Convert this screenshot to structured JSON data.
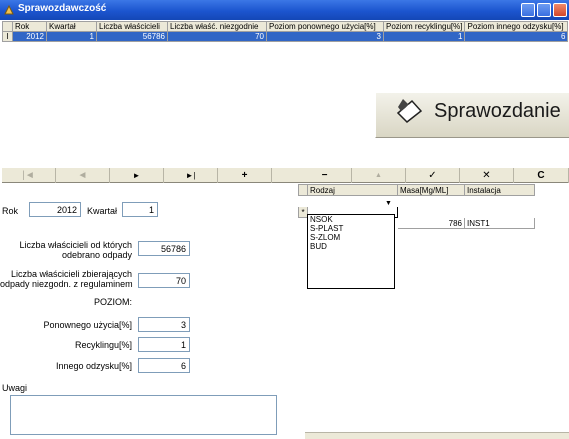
{
  "window": {
    "title": "Sprawozdawczość"
  },
  "top_grid": {
    "columns": [
      "Rok",
      "Kwartał",
      "Liczba właścicieli",
      "Liczba właść. niezgodnie",
      "Poziom ponownego użycia[%]",
      "Poziom recyklingu[%]",
      "Poziom innego odzysku[%]"
    ],
    "rows": [
      [
        "2012",
        "1",
        "56786",
        "70",
        "3",
        "1",
        "6"
      ]
    ],
    "row_indicator": "I"
  },
  "banner": {
    "label": "Sprawozdanie"
  },
  "navigator": {
    "buttons": [
      {
        "name": "first",
        "glyph": "|◄"
      },
      {
        "name": "prior",
        "glyph": "◄"
      },
      {
        "name": "next",
        "glyph": "►"
      },
      {
        "name": "last",
        "glyph": "►|"
      },
      {
        "name": "insert",
        "glyph": "+"
      },
      {
        "name": "delete",
        "glyph": "−"
      },
      {
        "name": "edit",
        "glyph": "▲"
      },
      {
        "name": "post",
        "glyph": "✓"
      },
      {
        "name": "cancel",
        "glyph": "✕"
      },
      {
        "name": "refresh",
        "glyph": "C"
      }
    ]
  },
  "form": {
    "rok_label": "Rok",
    "rok_value": "2012",
    "kwartal_label": "Kwartał",
    "kwartal_value": "1",
    "liczba_label_1": "Liczba właścicieli od których",
    "liczba_label_2": "odebrano odpady",
    "liczba_value": "56786",
    "niezgodn_label_1": "Liczba właścicieli zbierających",
    "niezgodn_label_2": "odpady niezgodn. z regulaminem",
    "niezgodn_value": "70",
    "poziom_heading": "POZIOM:",
    "ponownego_label": "Ponownego użycia[%]",
    "ponownego_value": "3",
    "recyklingu_label": "Recyklingu[%]",
    "recyklingu_value": "1",
    "innego_label": "Innego odzysku[%]",
    "innego_value": "6",
    "uwagi_label": "Uwagi",
    "uwagi_value": ""
  },
  "detail_grid": {
    "columns": [
      "Rodzaj",
      "Masa[Mg/ML]",
      "Instalacja"
    ],
    "new_row_marker": "*",
    "row_masa": "786",
    "row_instalacja": "INST1",
    "dropdown_options": [
      "NSOK",
      "S-PLAST",
      "S-ZLOM",
      "BUD"
    ]
  },
  "colors": {
    "titlebar": "#1c55cf",
    "selection": "#3166c6",
    "face": "#ece9d8"
  }
}
